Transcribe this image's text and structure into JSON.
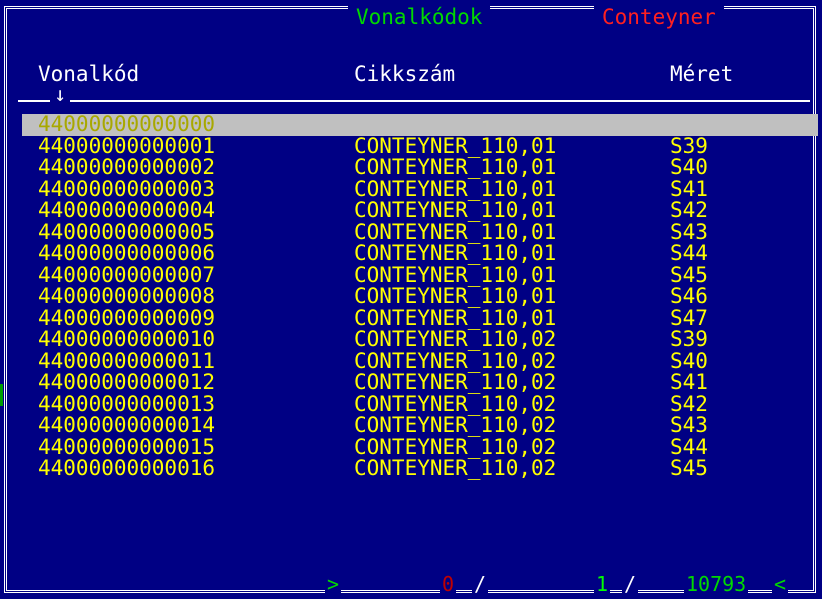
{
  "titles": {
    "left": "Vonalkódok",
    "right": "Conteyner"
  },
  "colors": {
    "background": "#000084",
    "frame": "#ffffff",
    "row_text": "#ffff00",
    "selected_bg": "#c0c0c0",
    "title_left": "#00d800",
    "title_right": "#ff2020"
  },
  "columns": {
    "barcode": "Vonalkód",
    "article": "Cikkszám",
    "size": "Méret"
  },
  "sort_indicator": "↓",
  "rows": [
    {
      "barcode": "44000000000000",
      "article": "",
      "size": ""
    },
    {
      "barcode": "44000000000001",
      "article": "CONTEYNER_110,01",
      "size": "S39"
    },
    {
      "barcode": "44000000000002",
      "article": "CONTEYNER_110,01",
      "size": "S40"
    },
    {
      "barcode": "44000000000003",
      "article": "CONTEYNER_110,01",
      "size": "S41"
    },
    {
      "barcode": "44000000000004",
      "article": "CONTEYNER_110,01",
      "size": "S42"
    },
    {
      "barcode": "44000000000005",
      "article": "CONTEYNER_110,01",
      "size": "S43"
    },
    {
      "barcode": "44000000000006",
      "article": "CONTEYNER_110,01",
      "size": "S44"
    },
    {
      "barcode": "44000000000007",
      "article": "CONTEYNER_110,01",
      "size": "S45"
    },
    {
      "barcode": "44000000000008",
      "article": "CONTEYNER_110,01",
      "size": "S46"
    },
    {
      "barcode": "44000000000009",
      "article": "CONTEYNER_110,01",
      "size": "S47"
    },
    {
      "barcode": "44000000000010",
      "article": "CONTEYNER_110,02",
      "size": "S39"
    },
    {
      "barcode": "44000000000011",
      "article": "CONTEYNER_110,02",
      "size": "S40"
    },
    {
      "barcode": "44000000000012",
      "article": "CONTEYNER_110,02",
      "size": "S41"
    },
    {
      "barcode": "44000000000013",
      "article": "CONTEYNER_110,02",
      "size": "S42"
    },
    {
      "barcode": "44000000000014",
      "article": "CONTEYNER_110,02",
      "size": "S43"
    },
    {
      "barcode": "44000000000015",
      "article": "CONTEYNER_110,02",
      "size": "S44"
    },
    {
      "barcode": "44000000000016",
      "article": "CONTEYNER_110,02",
      "size": "S45"
    }
  ],
  "selected_row": 0,
  "status": {
    "left_arrow": ">",
    "marked": "0",
    "sep1": "/",
    "current": "1",
    "sep2": "/",
    "total": "10793",
    "right_arrow": "<"
  }
}
